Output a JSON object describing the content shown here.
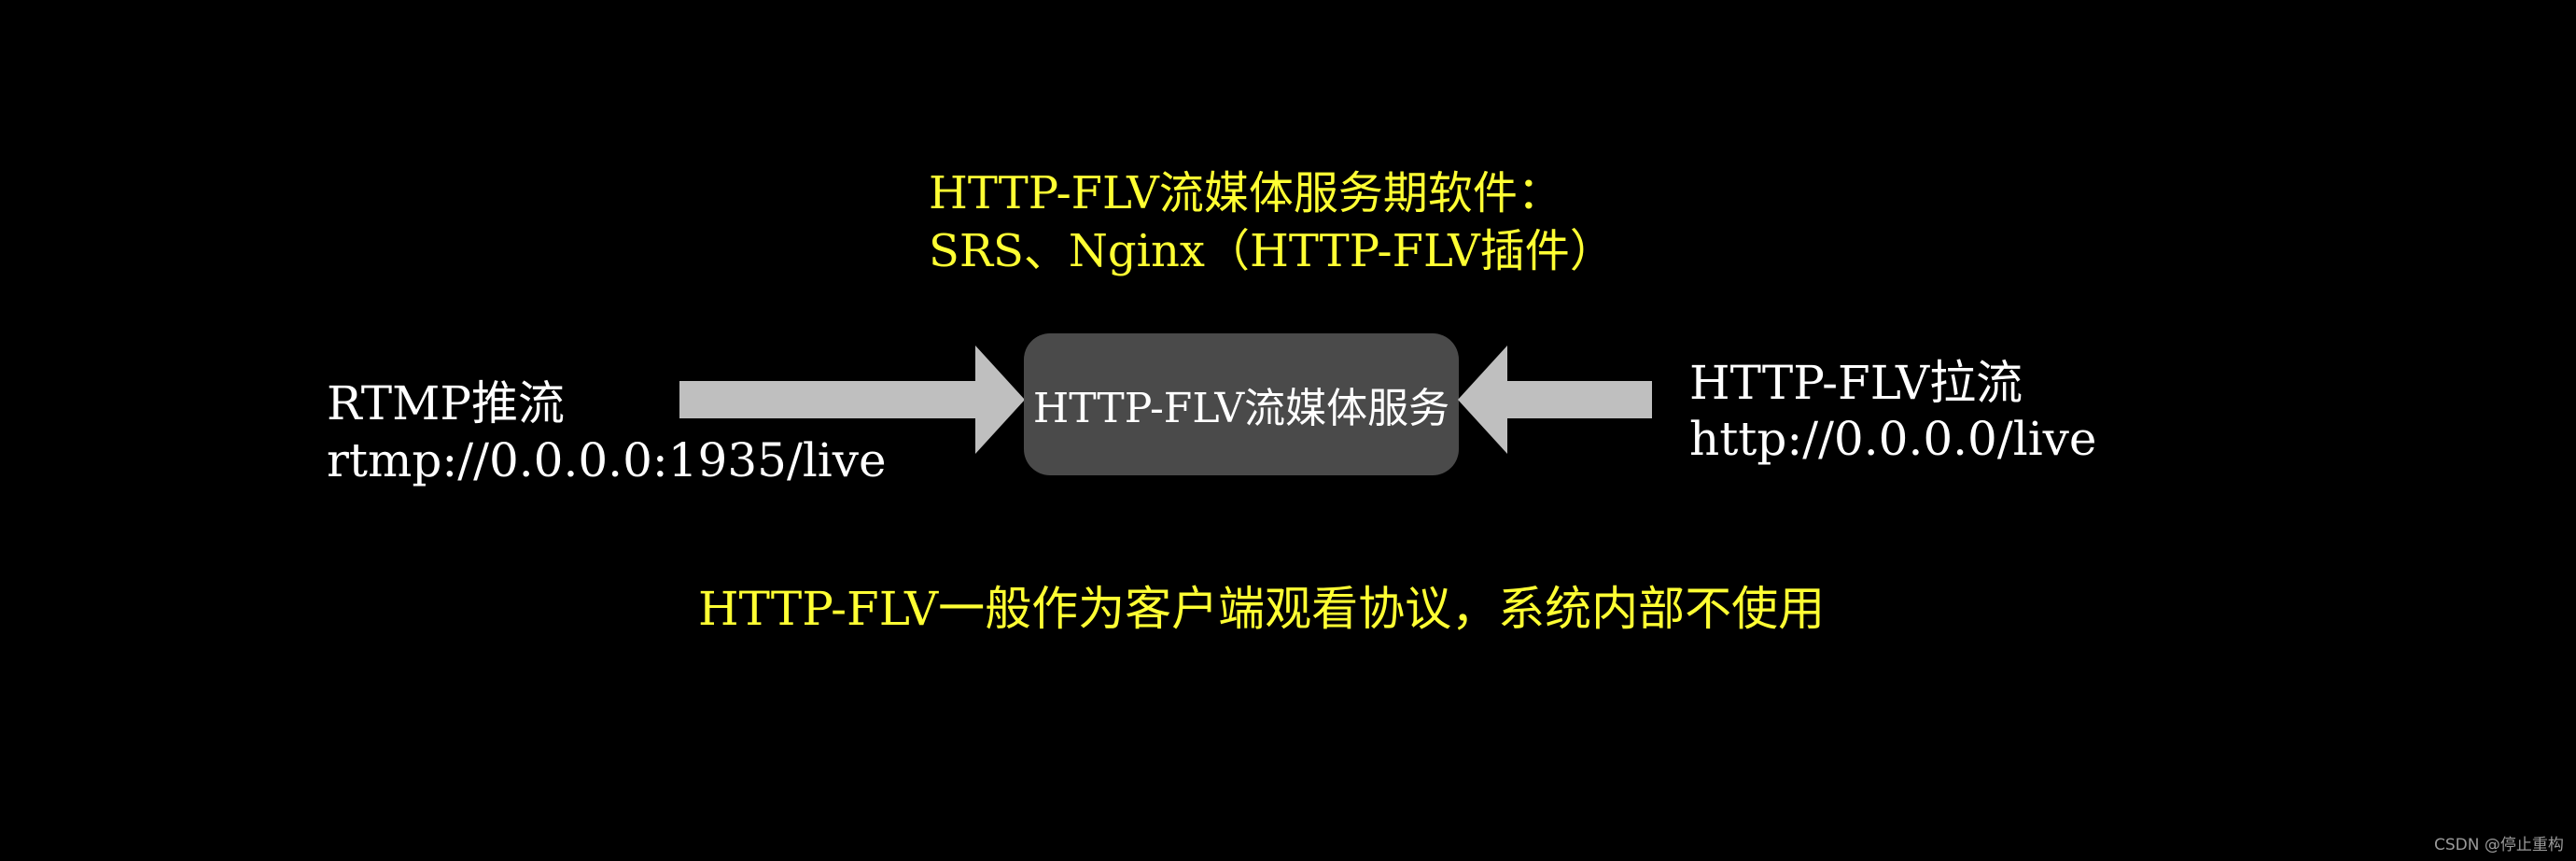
{
  "diagram": {
    "software_title": "HTTP-FLV流媒体服务期软件：",
    "software_list": "SRS、Nginx（HTTP-FLV插件）",
    "push": {
      "label": "RTMP推流",
      "url": "rtmp://0.0.0.0:1935/live"
    },
    "server_label": "HTTP-FLV流媒体服务",
    "pull": {
      "label": "HTTP-FLV拉流",
      "url": "http://0.0.0.0/live"
    },
    "note": "HTTP-FLV一般作为客户端观看协议，系统内部不使用",
    "watermark": "CSDN @停止重构"
  },
  "colors": {
    "background": "#000000",
    "highlight_text": "#FFFF33",
    "normal_text": "#FFFFFF",
    "server_box": "#4a4a4a",
    "arrow": "#BFBFBF"
  }
}
